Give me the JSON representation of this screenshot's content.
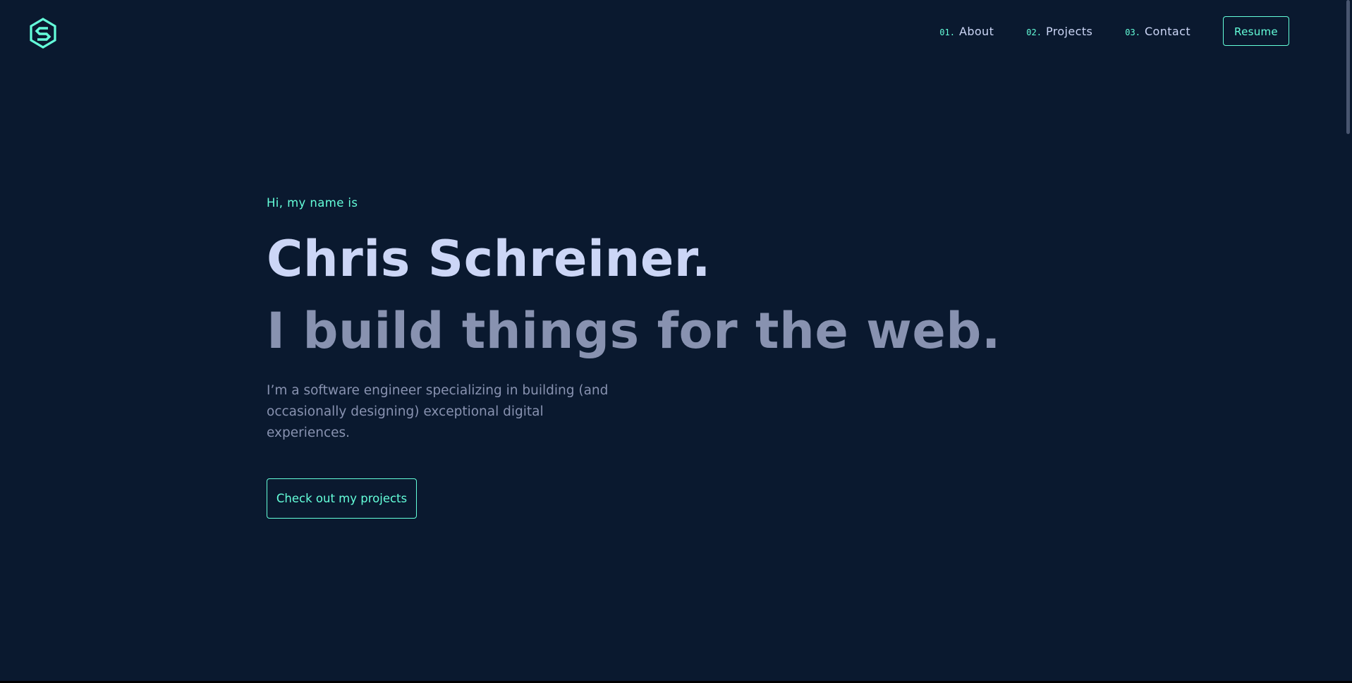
{
  "header": {
    "logo_icon": "hexagon-s-logo-icon",
    "nav": [
      {
        "number": "01.",
        "label": "About"
      },
      {
        "number": "02.",
        "label": "Projects"
      },
      {
        "number": "03.",
        "label": "Contact"
      }
    ],
    "resume_label": "Resume"
  },
  "hero": {
    "intro": "Hi, my name is",
    "name": "Chris Schreiner.",
    "tagline": "I build things for the web.",
    "description": "I’m a software engineer specializing in building (and occasionally designing) exceptional digital experiences.",
    "cta_label": "Check out my projects"
  },
  "colors": {
    "background": "#0a192f",
    "accent": "#64ffda",
    "heading": "#ccd6f6",
    "muted": "#8892b0",
    "scrollbar_thumb": "#495670"
  }
}
